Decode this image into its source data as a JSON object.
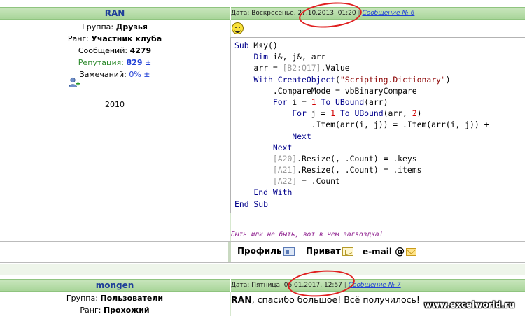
{
  "post1": {
    "username": "RAN",
    "group_label": "Группа:",
    "group_value": "Друзья",
    "rank_label": "Ранг:",
    "rank_value": "Участник клуба",
    "messages_label": "Сообщений:",
    "messages_value": "4279",
    "reputation_label": "Репутация:",
    "reputation_value": "829",
    "reputation_plusminus": "±",
    "remarks_label": "Замечаний:",
    "remarks_value": "0%",
    "remarks_plusminus": "±",
    "year": "2010",
    "date_label": "Дата: Воскресенье, 27.10.2013, 01:20",
    "separator": "|",
    "message_link": "Сообщение № 6",
    "code": [
      [
        {
          "t": "kw",
          "v": "Sub"
        },
        {
          "t": "pl",
          "v": " Мяу()"
        }
      ],
      [
        {
          "t": "pl",
          "v": "    "
        },
        {
          "t": "kw",
          "v": "Dim"
        },
        {
          "t": "pl",
          "v": " i&, j&, arr"
        }
      ],
      [
        {
          "t": "pl",
          "v": "    arr = "
        },
        {
          "t": "rng",
          "v": "[B2:Q17]"
        },
        {
          "t": "pl",
          "v": ".Value"
        }
      ],
      [
        {
          "t": "pl",
          "v": "    "
        },
        {
          "t": "kw",
          "v": "With"
        },
        {
          "t": "pl",
          "v": " "
        },
        {
          "t": "kw",
          "v": "CreateObject"
        },
        {
          "t": "pl",
          "v": "("
        },
        {
          "t": "str",
          "v": "\"Scripting.Dictionary\""
        },
        {
          "t": "pl",
          "v": ")"
        }
      ],
      [
        {
          "t": "pl",
          "v": "        .CompareMode = vbBinaryCompare"
        }
      ],
      [
        {
          "t": "pl",
          "v": "        "
        },
        {
          "t": "kw",
          "v": "For"
        },
        {
          "t": "pl",
          "v": " i = "
        },
        {
          "t": "num",
          "v": "1"
        },
        {
          "t": "pl",
          "v": " "
        },
        {
          "t": "kw",
          "v": "To"
        },
        {
          "t": "pl",
          "v": " "
        },
        {
          "t": "kw",
          "v": "UBound"
        },
        {
          "t": "pl",
          "v": "(arr)"
        }
      ],
      [
        {
          "t": "pl",
          "v": "            "
        },
        {
          "t": "kw",
          "v": "For"
        },
        {
          "t": "pl",
          "v": " j = "
        },
        {
          "t": "num",
          "v": "1"
        },
        {
          "t": "pl",
          "v": " "
        },
        {
          "t": "kw",
          "v": "To"
        },
        {
          "t": "pl",
          "v": " "
        },
        {
          "t": "kw",
          "v": "UBound"
        },
        {
          "t": "pl",
          "v": "(arr, "
        },
        {
          "t": "num",
          "v": "2"
        },
        {
          "t": "pl",
          "v": ")"
        }
      ],
      [
        {
          "t": "pl",
          "v": "                .Item(arr(i, j)) = .Item(arr(i, j)) +"
        }
      ],
      [
        {
          "t": "pl",
          "v": "            "
        },
        {
          "t": "kw",
          "v": "Next"
        }
      ],
      [
        {
          "t": "pl",
          "v": "        "
        },
        {
          "t": "kw",
          "v": "Next"
        }
      ],
      [
        {
          "t": "pl",
          "v": "        "
        },
        {
          "t": "rng",
          "v": "[A20]"
        },
        {
          "t": "pl",
          "v": ".Resize(, .Count) = .keys"
        }
      ],
      [
        {
          "t": "pl",
          "v": "        "
        },
        {
          "t": "rng",
          "v": "[A21]"
        },
        {
          "t": "pl",
          "v": ".Resize(, .Count) = .items"
        }
      ],
      [
        {
          "t": "pl",
          "v": "        "
        },
        {
          "t": "rng",
          "v": "[A22]"
        },
        {
          "t": "pl",
          "v": " = .Count"
        }
      ],
      [
        {
          "t": "pl",
          "v": "    "
        },
        {
          "t": "kw",
          "v": "End With"
        }
      ],
      [
        {
          "t": "kw",
          "v": "End Sub"
        }
      ]
    ],
    "signature": "Быть или не быть, вот в чем загвоздка!"
  },
  "profile_bar": {
    "profile_label": "Профиль",
    "private_label": "Приват",
    "email_label": "e-mail"
  },
  "post2": {
    "username": "mongen",
    "group_label": "Группа:",
    "group_value": "Пользователи",
    "rank_label": "Ранг:",
    "rank_value": "Прохожий",
    "date_label": "Дата: Пятница, 06.01.2017, 12:57",
    "separator": "|",
    "message_link": "Сообщение № 7",
    "text_bold": "RAN",
    "text_rest": ", спасибо большое! Всё получилось!"
  },
  "watermark": "www.excelworld.ru",
  "colors": {
    "header_green": "#a9d59a",
    "link_blue": "#1f3fd6",
    "code_keyword": "#00008b",
    "code_string": "#8b0000",
    "code_number": "#d00000",
    "annotation_red": "#e02020",
    "signature_purple": "#8b1a8b"
  }
}
